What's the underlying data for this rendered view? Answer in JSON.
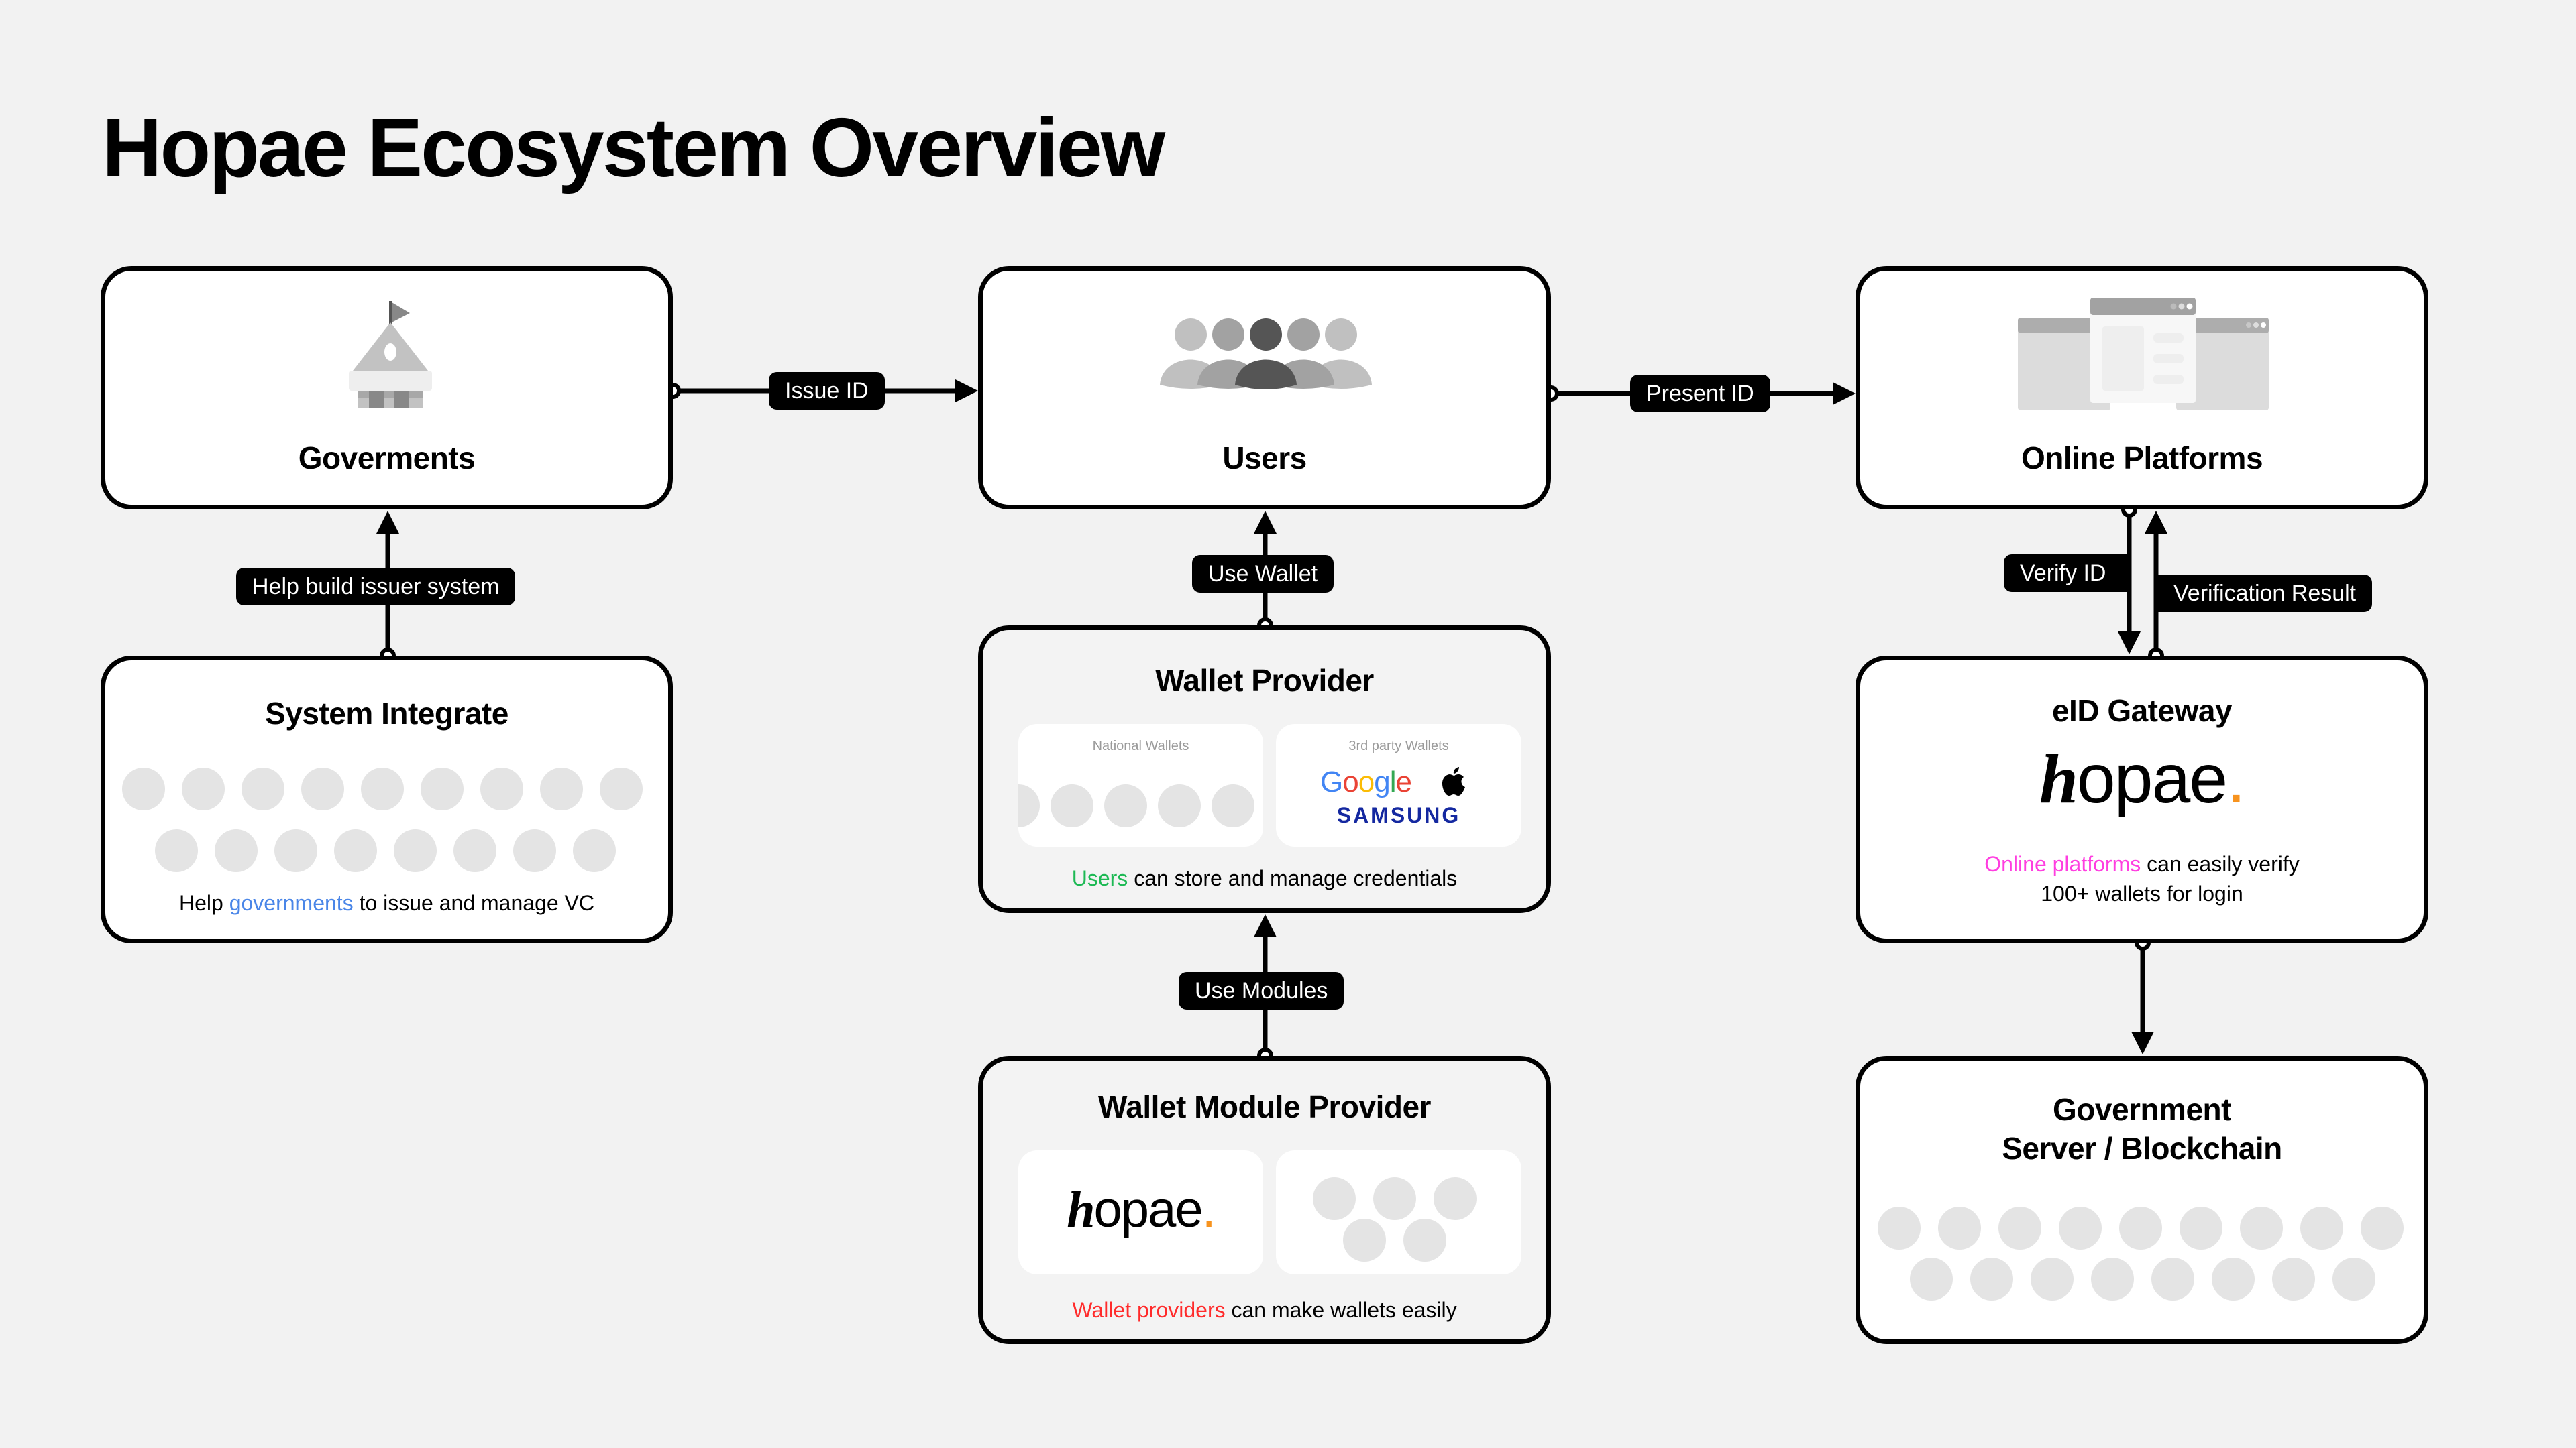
{
  "title": "Hopae Ecosystem Overview",
  "nodes": {
    "governments": {
      "title": "Goverments",
      "icon": "government-building-icon"
    },
    "users": {
      "title": "Users",
      "icon": "users-group-icon"
    },
    "online_platforms": {
      "title": "Online Platforms",
      "icon": "browser-windows-icon"
    },
    "system_integrate": {
      "title": "System Integrate",
      "caption_prefix": "Help ",
      "caption_highlight": "governments",
      "caption_suffix": " to issue and manage VC",
      "highlight_color": "#4a86e8",
      "placeholder_logo_count": 17
    },
    "wallet_provider": {
      "title": "Wallet Provider",
      "national_wallets_label": "National Wallets",
      "third_party_label": "3rd party Wallets",
      "third_party_brands": [
        "Google",
        "Apple",
        "SAMSUNG"
      ],
      "caption_highlight": "Users",
      "caption_suffix": " can store and manage credentials",
      "highlight_color": "#1db954"
    },
    "eid_gateway": {
      "title": "eID Gateway",
      "logo_text": "hopae",
      "logo_dot": ".",
      "caption_highlight": "Online platforms",
      "caption_line1_suffix": " can easily verify",
      "caption_line2": "100+ wallets for login",
      "highlight_color": "#ff3ee0"
    },
    "wallet_module_provider": {
      "title": "Wallet Module Provider",
      "logo_text": "hopae",
      "logo_dot": ".",
      "caption_highlight": "Wallet providers",
      "caption_suffix": " can make wallets easily",
      "highlight_color": "#ff2b2b"
    },
    "government_server": {
      "title_line1": "Government",
      "title_line2": "Server / Blockchain",
      "placeholder_logo_count": 17
    }
  },
  "edges": {
    "issue_id": "Issue ID",
    "present_id": "Present ID",
    "help_build": "Help build issuer system",
    "use_wallet": "Use Wallet",
    "use_modules": "Use Modules",
    "verify_id": "Verify ID",
    "verification_result": "Verification Result"
  },
  "colors": {
    "brand_dot": "#f7931e",
    "samsung_blue": "#1428a0"
  }
}
